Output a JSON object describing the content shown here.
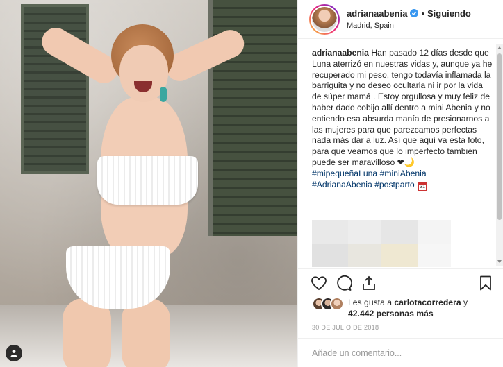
{
  "post": {
    "username": "adrianaabenia",
    "follow_status": "Siguiendo",
    "location": "Madrid, Spain",
    "caption_username": "adrianaabenia",
    "caption_text": "Han pasado 12 días desde que Luna aterrizó en nuestras vidas y, aunque ya he recuperado mi peso, tengo todavía inflamada la barriguita y no deseo ocultarla ni ir por la vida de súper mamá . Estoy orgullosa y muy feliz de haber dado cobijo allí dentro a mini Abenia y no entiendo esa absurda manía de presionarnos a las mujeres para que parezcamos perfectas nada más dar a luz. Así que aquí va esta foto, para que veamos que lo imperfecto también puede ser maravilloso ❤🌙",
    "hashtags_line1": "#mipequeñaLuna #miniAbenia",
    "hashtags_line2": "#AdrianaAbenia #postparto",
    "calendar_icon_text": "31"
  },
  "likes": {
    "prefix": "Les gusta a ",
    "user": "carlotacorredera",
    "middle": " y",
    "count": "42.442 personas más"
  },
  "date": "30 DE JULIO DE 2018",
  "comment": {
    "placeholder": "Añade un comentario..."
  },
  "icons": {
    "verified": "verified-badge-icon",
    "like": "heart-icon",
    "comment": "comment-bubble-icon",
    "share": "share-icon",
    "save": "bookmark-icon",
    "tag": "user-tag-icon"
  },
  "colors": {
    "verified_blue": "#3897f0",
    "hashtag_blue": "#003569",
    "text": "#262626",
    "muted": "#999999",
    "border": "#efefef"
  }
}
